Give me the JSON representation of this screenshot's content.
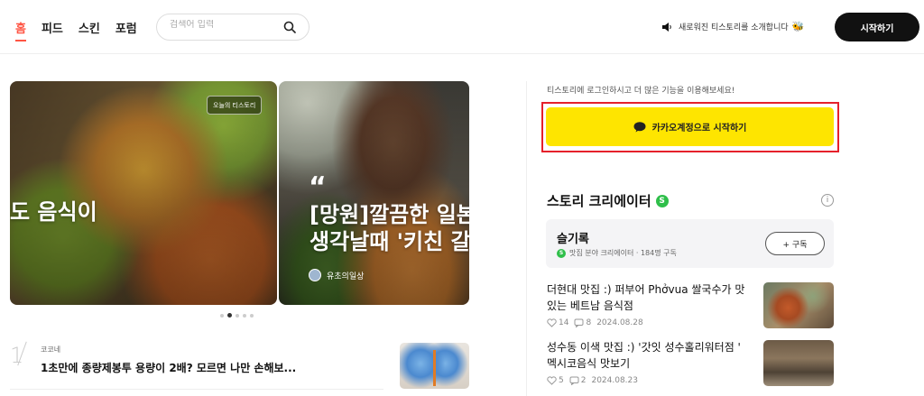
{
  "header": {
    "nav": [
      "홈",
      "피드",
      "스킨",
      "포럼"
    ],
    "search_placeholder": "검색어 입력",
    "notice": "새로워진 티스토리를 소개합니다",
    "start_button": "시작하기"
  },
  "carousel": {
    "badge": "오늘의 티스토리",
    "slides": [
      {
        "title": "도 음식이"
      },
      {
        "quote": "“",
        "title_line1": "[망원]깔끔한 일본",
        "title_line2": "생각날때 '키친 갈마",
        "author": "유초의일상"
      }
    ],
    "active_dot": 1,
    "dot_count": 5
  },
  "ranking": {
    "number": "1",
    "source": "코코네",
    "title": "1초만에 종량제봉투 용량이 2배? 모르면 나만 손해보..."
  },
  "sidebar": {
    "login_hint": "티스토리에 로그인하시고 더 많은 기능을 이용해보세요!",
    "kakao_button": "카카오계정으로 시작하기",
    "creator_section_title": "스토리 크리에이터",
    "s_badge": "S",
    "info": "i",
    "creator": {
      "name": "슬기록",
      "meta": "맛집 분야 크리에이터 · 184명 구독",
      "subscribe": "+ 구독"
    },
    "posts": [
      {
        "title": "더현대 맛집 :) 퍼부어 Phởvua 쌀국수가 맛있는 베트남 음식점",
        "likes": "14",
        "comments": "8",
        "date": "2024.08.28"
      },
      {
        "title": "성수동 이색 맛집 :) '갓잇 성수홀리워터점 ' 멕시코음식 맛보기",
        "likes": "5",
        "comments": "2",
        "date": "2024.08.23"
      }
    ]
  },
  "colors": {
    "accent": "#ff5544",
    "kakao": "#fee500",
    "highlight": "#e5202b",
    "badge_green": "#2fbf4a"
  }
}
